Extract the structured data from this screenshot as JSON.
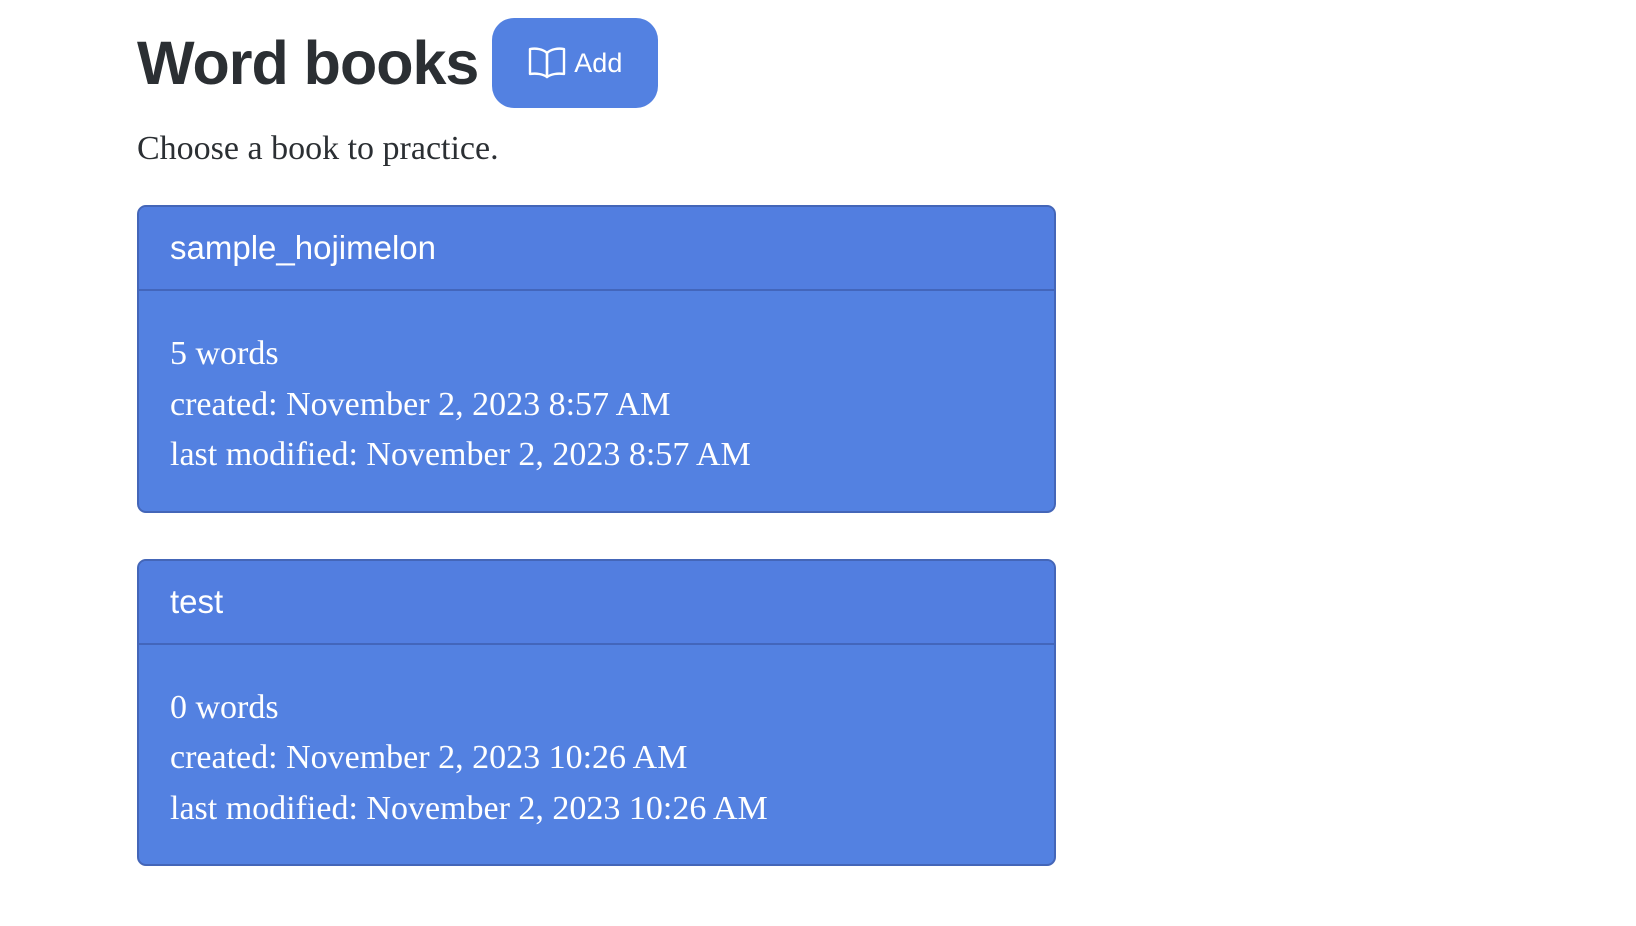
{
  "header": {
    "title": "Word books",
    "add_label": "Add",
    "add_icon": "open-book-icon"
  },
  "subtitle": "Choose a book to practice.",
  "colors": {
    "primary": "#5381e1",
    "title_text": "#2b2f33"
  },
  "books": [
    {
      "name": "sample_hojimelon",
      "words": "5 words",
      "created": "created: November 2, 2023 8:57 AM",
      "modified": "last modified: November 2, 2023 8:57 AM"
    },
    {
      "name": "test",
      "words": "0 words",
      "created": "created: November 2, 2023 10:26 AM",
      "modified": "last modified: November 2, 2023 10:26 AM"
    }
  ]
}
